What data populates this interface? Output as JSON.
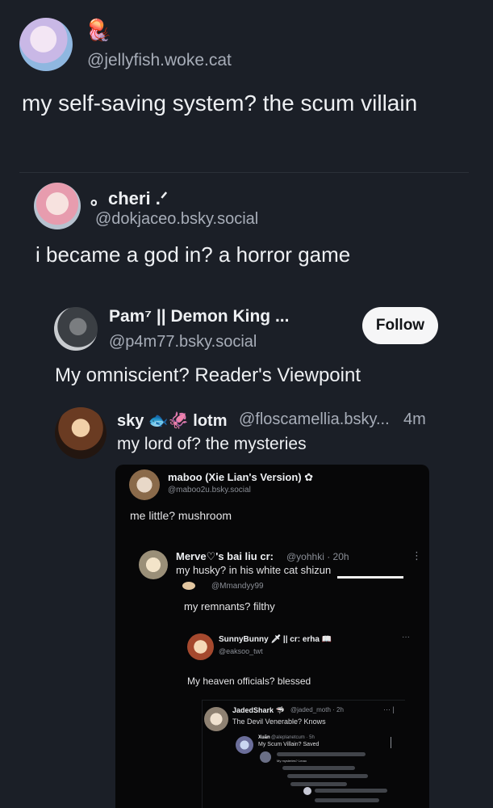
{
  "post": {
    "author_emoji": "🪼",
    "handle": "@jellyfish.woke.cat",
    "text": "my self-saving system? the scum villain"
  },
  "quote1": {
    "name": "。cheri  .ᐟ",
    "handle": "@dokjaceo.bsky.social",
    "text": "i became a god in? a horror game"
  },
  "quote2": {
    "name": "Pam⁷ || Demon King ...",
    "handle": "@p4m77.bsky.social",
    "follow_label": "Follow",
    "text": "My omniscient? Reader's Viewpoint"
  },
  "quote3": {
    "name": "sky 🐟🦑 lotm",
    "handle": "@floscamellia.bsky...",
    "time": "4m",
    "text": "my lord of? the mysteries"
  },
  "screenshot": {
    "maboo": {
      "name": "maboo (Xie Lian's Version) ✿",
      "handle": "@maboo2u.bsky.social",
      "text": "me little? mushroom"
    },
    "merve": {
      "name": "Merve♡'s bai liu cr:",
      "handle": "@yohhki · 20h",
      "text": "my husky? in his white cat shizun",
      "more": "⋮"
    },
    "mandyy": {
      "handle": "@Mmandyy99",
      "text": "my remnants? filthy"
    },
    "sunny": {
      "name": "SunnyBunny 🗡 || cr: erha 📖",
      "handle": "@eaksoo_twt",
      "text": "My heaven officials? blessed",
      "more": "···"
    },
    "jaded": {
      "name": "JadedShark 🦈",
      "handle": "@jaded_moth · 2h",
      "text": "The Devil Venerable? Knows",
      "more": "··· |"
    },
    "xuan": {
      "name": "Xuān",
      "handle": "@aleplanetcum · 5h",
      "text": "My Scum Villain? Saved"
    },
    "deep": {
      "line1": "My mysteries? Lmao"
    }
  }
}
